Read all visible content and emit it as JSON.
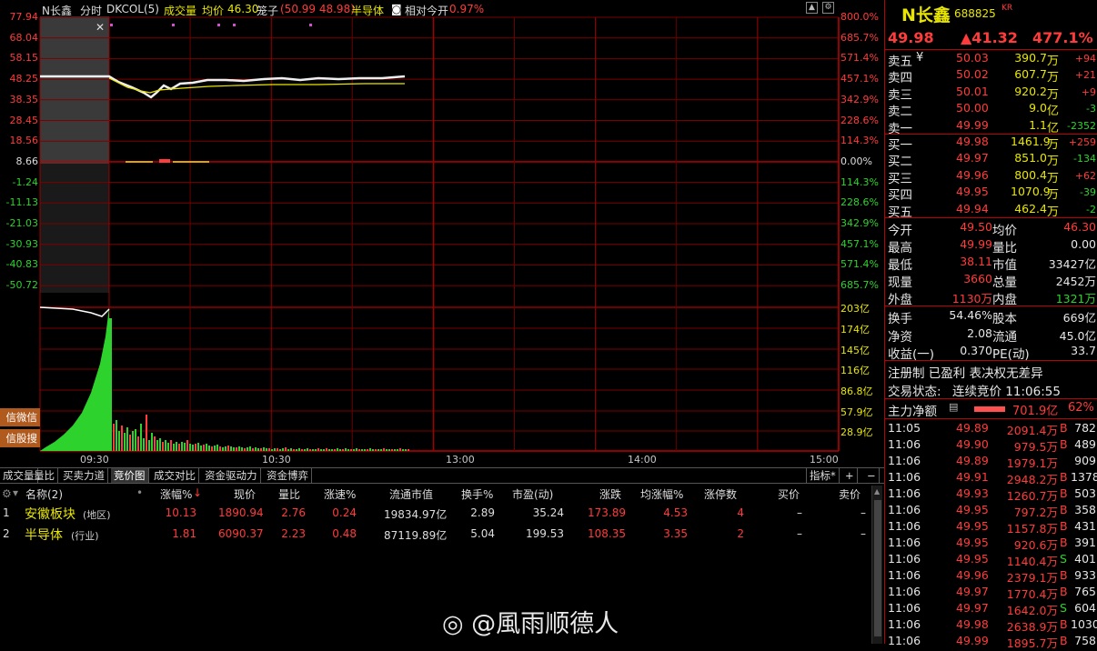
{
  "chart_header": {
    "name": "N长鑫",
    "period": "分时",
    "indicator": "DKCOL(5)",
    "vol_label": "成交量",
    "avg_label": "均价",
    "avg_value": "46.30",
    "penzi_label": "笼子",
    "penzi_value": "(50.99 48.98)",
    "sector": "半导体",
    "rel_label": "相对今开",
    "rel_value": "0.97%"
  },
  "left_axis": [
    "77.94",
    "68.04",
    "58.15",
    "48.25",
    "38.35",
    "28.45",
    "18.56",
    "8.66",
    "-1.24",
    "-11.13",
    "-21.03",
    "-30.93",
    "-40.83",
    "-50.72"
  ],
  "right_axis": [
    "800.0%",
    "685.7%",
    "571.4%",
    "457.1%",
    "342.9%",
    "228.6%",
    "114.3%",
    "0.00%",
    "114.3%",
    "228.6%",
    "342.9%",
    "457.1%",
    "571.4%",
    "685.7%"
  ],
  "vol_axis": [
    "203亿",
    "174亿",
    "145亿",
    "116亿",
    "86.8亿",
    "57.9亿",
    "28.9亿"
  ],
  "time_axis": [
    "09:30",
    "10:30",
    "13:00",
    "14:00",
    "15:00"
  ],
  "side_buttons": [
    "信微信",
    "信股搜"
  ],
  "tabs": [
    "成交量",
    "量比",
    "买卖力道",
    "竞价图",
    "成交对比",
    "资金驱动力",
    "资金博弈"
  ],
  "tab_active": 3,
  "tab_right": [
    "指标*",
    "+",
    "−"
  ],
  "table": {
    "headers": [
      "名称(2)",
      "涨幅%",
      "现价",
      "量比",
      "涨速%",
      "流通市值",
      "换手%",
      "市盈(动)",
      "涨跌",
      "均涨幅%",
      "涨停数",
      "买价",
      "卖价"
    ],
    "rows": [
      {
        "idx": "1",
        "name": "安徽板块",
        "tag": "(地区)",
        "cells": [
          "10.13",
          "1890.94",
          "2.76",
          "0.24",
          "19834.97亿",
          "2.89",
          "35.24",
          "173.89",
          "4.53",
          "4",
          "–",
          "–"
        ]
      },
      {
        "idx": "2",
        "name": "半导体",
        "tag": "(行业)",
        "cells": [
          "1.81",
          "6090.37",
          "2.23",
          "0.48",
          "87119.89亿",
          "5.04",
          "199.53",
          "108.35",
          "3.35",
          "2",
          "–",
          "–"
        ]
      }
    ]
  },
  "watermark": "@風雨顺德人",
  "quote": {
    "name": "N长鑫",
    "code": "688825",
    "flag": "KR",
    "price": "49.98",
    "change": "▲41.32",
    "pct": "477.1%",
    "asks": [
      {
        "label": "卖五",
        "mark": "¥",
        "price": "50.03",
        "vol": "390.7",
        "unit": "万",
        "chg": "+94"
      },
      {
        "label": "卖四",
        "mark": "",
        "price": "50.02",
        "vol": "607.7",
        "unit": "万",
        "chg": "+21"
      },
      {
        "label": "卖三",
        "mark": "",
        "price": "50.01",
        "vol": "920.2",
        "unit": "万",
        "chg": "+9"
      },
      {
        "label": "卖二",
        "mark": "",
        "price": "50.00",
        "vol": "9.0",
        "unit": "亿",
        "chg": "-3"
      },
      {
        "label": "卖一",
        "mark": "",
        "price": "49.99",
        "vol": "1.1",
        "unit": "亿",
        "chg": "-2352"
      }
    ],
    "bids": [
      {
        "label": "买一",
        "price": "49.98",
        "vol": "1461.9",
        "unit": "万",
        "chg": "+259"
      },
      {
        "label": "买二",
        "price": "49.97",
        "vol": "851.0",
        "unit": "万",
        "chg": "-134"
      },
      {
        "label": "买三",
        "price": "49.96",
        "vol": "800.4",
        "unit": "万",
        "chg": "+62"
      },
      {
        "label": "买四",
        "price": "49.95",
        "vol": "1070.9",
        "unit": "万",
        "chg": "-39"
      },
      {
        "label": "买五",
        "price": "49.94",
        "vol": "462.4",
        "unit": "万",
        "chg": "-2"
      }
    ],
    "stats": [
      {
        "l1": "今开",
        "v1": "49.50",
        "l2": "均价",
        "v2": "46.30"
      },
      {
        "l1": "最高",
        "v1": "49.99",
        "l2": "量比",
        "v2": "0.00"
      },
      {
        "l1": "最低",
        "v1": "38.11",
        "l2": "市值",
        "v2": "33427亿"
      },
      {
        "l1": "现量",
        "v1": "3660",
        "l2": "总量",
        "v2": "2452万"
      },
      {
        "l1": "外盘",
        "v1": "1130万",
        "l2": "内盘",
        "v2": "1321万"
      }
    ],
    "stats2": [
      {
        "l1": "换手",
        "v1": "54.46%",
        "l2": "股本",
        "v2": "669亿"
      },
      {
        "l1": "净资",
        "v1": "2.08",
        "l2": "流通",
        "v2": "45.0亿"
      },
      {
        "l1": "收益(一)",
        "v1": "0.370",
        "l2": "PE(动)",
        "v2": "33.7"
      }
    ],
    "info1": "注册制 已盈利 表决权无差异",
    "info2_label": "交易状态:",
    "info2_value": "连续竞价 11:06:55",
    "main_label": "主力净额",
    "main_value": "701.9亿",
    "main_pct": "62%",
    "ticks": [
      {
        "t": "11:05",
        "p": "49.89",
        "v": "2091.4万",
        "s": "B",
        "n": "782"
      },
      {
        "t": "11:06",
        "p": "49.90",
        "v": "979.5万",
        "s": "B",
        "n": "489"
      },
      {
        "t": "11:06",
        "p": "49.89",
        "v": "1979.1万",
        "s": "",
        "n": "909"
      },
      {
        "t": "11:06",
        "p": "49.91",
        "v": "2948.2万",
        "s": "B",
        "n": "1378"
      },
      {
        "t": "11:06",
        "p": "49.93",
        "v": "1260.7万",
        "s": "B",
        "n": "503"
      },
      {
        "t": "11:06",
        "p": "49.95",
        "v": "797.2万",
        "s": "B",
        "n": "358"
      },
      {
        "t": "11:06",
        "p": "49.95",
        "v": "1157.8万",
        "s": "B",
        "n": "431"
      },
      {
        "t": "11:06",
        "p": "49.95",
        "v": "920.6万",
        "s": "B",
        "n": "391"
      },
      {
        "t": "11:06",
        "p": "49.95",
        "v": "1140.4万",
        "s": "S",
        "n": "401"
      },
      {
        "t": "11:06",
        "p": "49.96",
        "v": "2379.1万",
        "s": "B",
        "n": "933"
      },
      {
        "t": "11:06",
        "p": "49.97",
        "v": "1770.4万",
        "s": "B",
        "n": "765"
      },
      {
        "t": "11:06",
        "p": "49.97",
        "v": "1642.0万",
        "s": "S",
        "n": "604"
      },
      {
        "t": "11:06",
        "p": "49.98",
        "v": "2638.9万",
        "s": "B",
        "n": "1030"
      },
      {
        "t": "11:06",
        "p": "49.99",
        "v": "1895.7万",
        "s": "B",
        "n": "758"
      }
    ]
  },
  "colors": {
    "up": "#ff3b3b",
    "down": "#2dd22d",
    "grid": "#8b0000",
    "accent": "#e8e600"
  }
}
